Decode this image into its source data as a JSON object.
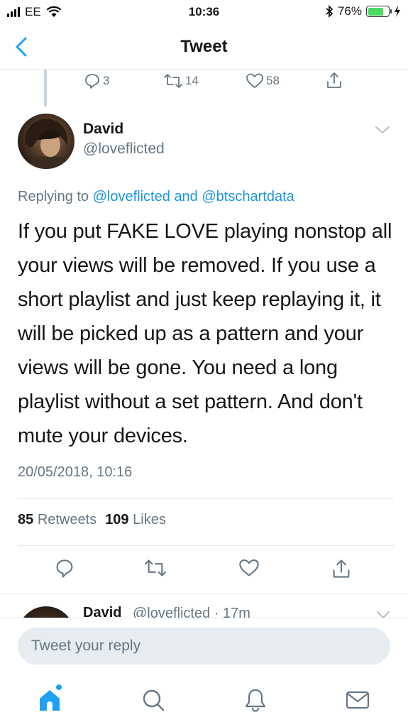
{
  "status_bar": {
    "carrier": "EE",
    "time": "10:36",
    "battery": "76%",
    "battery_level": 0.76
  },
  "nav": {
    "title": "Tweet"
  },
  "prev_tweet_actions": {
    "replies": "3",
    "retweets": "14",
    "likes": "58"
  },
  "tweet": {
    "author_name": "David",
    "author_handle": "@loveflicted",
    "replying_prefix": "Replying to",
    "replying_user1": "@loveflicted",
    "replying_and": "and",
    "replying_user2": "@btschartdata",
    "text": "If you put FAKE LOVE playing nonstop all your views will be removed. If you use a short playlist and just keep replaying it, it will be picked up as a pattern and your views will be gone. You need a long playlist without a set pattern. And don't mute your devices.",
    "timestamp": "20/05/2018, 10:16",
    "retweet_count": "85",
    "retweet_label": "Retweets",
    "like_count": "109",
    "like_label": "Likes"
  },
  "next_tweet": {
    "author_name": "David",
    "meta": "@loveflicted · 17m"
  },
  "reply": {
    "placeholder": "Tweet your reply"
  },
  "colors": {
    "accent": "#1da1f2",
    "secondary_text": "#657786",
    "link": "#1b95e0"
  },
  "tabs": [
    {
      "icon": "home-icon"
    },
    {
      "icon": "search-icon"
    },
    {
      "icon": "bell-icon"
    },
    {
      "icon": "mail-icon"
    }
  ]
}
